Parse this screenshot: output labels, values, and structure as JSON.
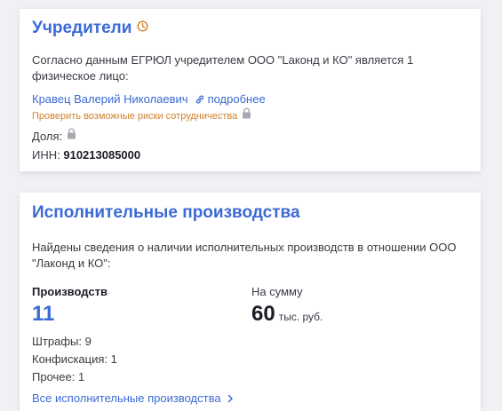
{
  "founders": {
    "title": "Учредители",
    "description": "Согласно данным ЕГРЮЛ учредителем ООО \"Laконд и КО\" является 1 физическое лицо:",
    "person_name": "Кравец Валерий Николаевич",
    "more_link": "подробнее",
    "risk_link": "Проверить возможные риски сотрудничества",
    "share_label": "Доля:",
    "inn_label": "ИНН:",
    "inn_value": "910213085000"
  },
  "enforcement": {
    "title": "Исполнительные производства",
    "description": "Найдены сведения о наличии исполнительных производств в отношении ООО \"Лаконд и КО\":",
    "count_label": "Производств",
    "count_value": "11",
    "sum_label": "На сумму",
    "sum_value": "60",
    "sum_unit": "тыс. руб.",
    "fines": "Штрафы: 9",
    "confiscation": "Конфискация: 1",
    "other": "Прочее: 1",
    "all_link": "Все исполнительные производства"
  },
  "colors": {
    "accent": "#3b6ad6",
    "warning": "#d0822b",
    "icon_gray": "#a6a9b2"
  },
  "icons": [
    "clock-icon",
    "link-icon",
    "lock-icon",
    "chevron-right-icon"
  ]
}
